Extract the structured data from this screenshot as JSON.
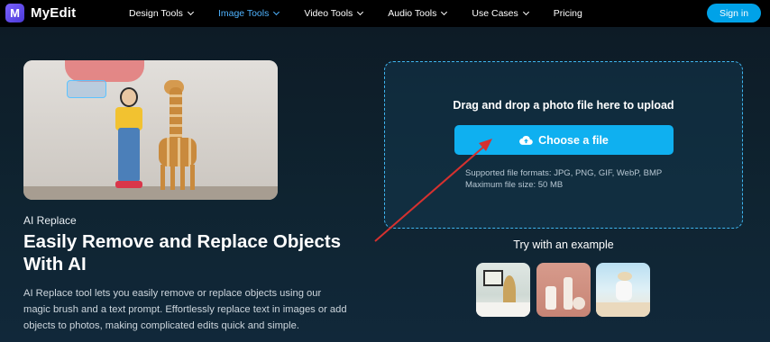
{
  "brand": {
    "name": "MyEdit",
    "logo_letter": "M",
    "accent": "#00a2e8"
  },
  "nav": {
    "items": [
      {
        "label": "Design Tools",
        "has_dropdown": true,
        "active": false
      },
      {
        "label": "Image Tools",
        "has_dropdown": true,
        "active": true
      },
      {
        "label": "Video Tools",
        "has_dropdown": true,
        "active": false
      },
      {
        "label": "Audio Tools",
        "has_dropdown": true,
        "active": false
      },
      {
        "label": "Use Cases",
        "has_dropdown": true,
        "active": false
      },
      {
        "label": "Pricing",
        "has_dropdown": false,
        "active": false
      }
    ],
    "signin_label": "Sign in",
    "active_color": "#4fb3ff"
  },
  "hero": {
    "eyebrow": "AI Replace",
    "headline": "Easily Remove and Replace Objects With AI",
    "description": "AI Replace tool lets you easily remove or replace objects using our magic brush and a text prompt. Effortlessly replace text in images or add objects to photos, making complicated edits quick and simple."
  },
  "upload": {
    "title": "Drag and drop a photo file here to upload",
    "button_label": "Choose a file",
    "button_icon": "cloud-upload-icon",
    "formats_line": "Supported file formats: JPG, PNG, GIF, WebP, BMP",
    "size_line": "Maximum file size: 50 MB"
  },
  "examples": {
    "title": "Try with an example",
    "items": [
      {
        "name": "example-vase-room"
      },
      {
        "name": "example-cosmetics"
      },
      {
        "name": "example-beach-woman"
      }
    ]
  },
  "annotation": {
    "arrow_color": "#d6312f"
  }
}
